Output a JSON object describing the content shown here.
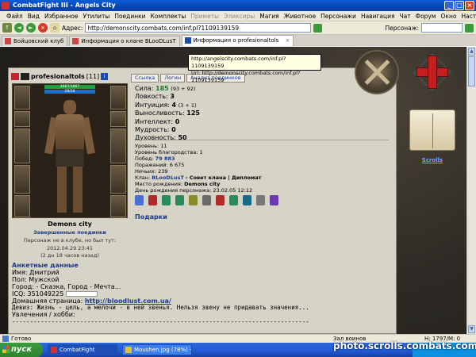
{
  "window": {
    "title": "CombatFight III - Angels City"
  },
  "menu": [
    "Файл",
    "Вид",
    "Избранное",
    "Утилиты",
    "Поединки",
    "Комплекты",
    "Приметы",
    "Эликсиры",
    "Магия",
    "Животное",
    "Персонажи",
    "Навигация",
    "Чат",
    "Форум",
    "Окно",
    "Настройки",
    "?"
  ],
  "address": {
    "label": "Адрес:",
    "url": "http://demonscity.combats.com/inf.pl?1109139159",
    "person_label": "Персонаж:"
  },
  "tabs": [
    {
      "label": "Бойцовский клуб"
    },
    {
      "label": "Информация о клане BLooDLusT"
    },
    {
      "label": "Информация о profesionaltols",
      "close": "×"
    }
  ],
  "tooltip": {
    "line1": "http://angelscity.combats.com/inf.pl?1109139159",
    "line2": "Url: http://demonscity.combats.com/inf.pl?1109139159"
  },
  "char": {
    "name": "profesionaltols",
    "level": "[11]",
    "info_icon": "i",
    "buttons": [
      "Ссылка",
      "Логин",
      "Анализ поединков"
    ],
    "hp": "3667/3667",
    "mp": "28/28"
  },
  "stats": [
    {
      "label": "Сила:",
      "value": "185",
      "extra": "(93 + 92)"
    },
    {
      "label": "Ловкость:",
      "value": "3",
      "extra": ""
    },
    {
      "label": "Интуиция:",
      "value": "4",
      "extra": "(3 + 1)"
    },
    {
      "label": "Выносливость:",
      "value": "125",
      "extra": ""
    },
    {
      "label": "Интеллект:",
      "value": "0",
      "extra": ""
    },
    {
      "label": "Мудрость:",
      "value": "0",
      "extra": ""
    },
    {
      "label": "Духовность:",
      "value": "50",
      "extra": ""
    }
  ],
  "info": {
    "level": "Уровень: 11",
    "valor": "Уровень благородства: 1",
    "wins_label": "Побед:",
    "wins": "79 883",
    "losses": "Поражений: 6 675",
    "draws": "Ничьих: 239",
    "clan_label": "Клан:",
    "clan": "BLooDLusT",
    "clan_role": "- Совет клана | Дипломат",
    "birthplace_label": "Место рождения:",
    "birthplace": "Demons city",
    "birthday": "День рождения персонажа: 23.02.05 12:12"
  },
  "gifts_label": "Подарки",
  "under_avatar": {
    "city": "Demons city",
    "finished": "Завершенные поединки",
    "note": "Персонаж не в клубе, но был тут:",
    "datetime": "2012.04.29 23:41",
    "ago": "(2 дн 18 часов назад)"
  },
  "profile": {
    "heading": "Анкетные данные",
    "name": "Имя: Дмитрий",
    "gender": "Пол: Мужской",
    "city": "Город: - Сказка, Город - Мечта...",
    "icq": "ICQ: 351049225",
    "homepage_label": "Домашняя страница:",
    "homepage": "http://bloodlust.com.ua/",
    "motto": "Девиз: Жизнь - цель, а мелочи - в ней звенья. Нельзя звену не придавать значения...",
    "hobbies": "Увлечения / хобби:",
    "divider": "-----------------------------------------------------------------------------------"
  },
  "scrolls_label": "Scrolls",
  "status": {
    "ready": "Готово",
    "battle": "Зал воинов",
    "hp": "H: 1797/M: 0"
  },
  "taskbar": {
    "start": "пуск",
    "tasks": [
      {
        "label": "CombatFight"
      },
      {
        "label": "Moushen.jpg (78%) -"
      }
    ]
  },
  "watermark": "photo.scrolls.combats.com",
  "colors": {
    "title_blue": "#0845b5",
    "link_blue": "#1c3a86",
    "green": "#1d7a2a",
    "panel": "#d6d3c7"
  }
}
